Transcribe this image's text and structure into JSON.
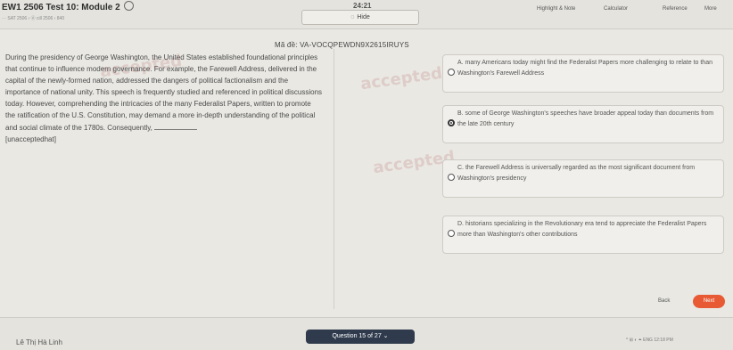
{
  "header": {
    "test_title": "EW1 2506 Test 10: Module 2",
    "breadcrumb": "··· SAT 2506 › Ⓐ cill 2506 ‹ 840",
    "timer": "24:21",
    "hide_label": "Hide",
    "tools": [
      "Highlight & Note",
      "Calculator",
      "Reference",
      "More"
    ]
  },
  "question": {
    "id_label": "Mã đề: VA-VOCQPEWDN9X2615IRUYS",
    "passage": "During the presidency of George Washington, the United States established foundational principles that continue to influence modern governance. For example, the Farewell Address, delivered in the capital of the newly-formed nation, addressed the dangers of political factionalism and the importance of national unity. This speech is frequently studied and referenced in political discussions today. However, comprehending the intricacies of the many Federalist Papers, written to promote the ratification of the U.S. Constitution, may demand a more in-depth understanding of the political and social climate of the 1780s. Consequently,",
    "passage_tail": "[unacceptedhat]",
    "choices": [
      {
        "text": "A. many Americans today might find the Federalist Papers more challenging to relate to than Washington's Farewell Address",
        "selected": false
      },
      {
        "text": "B. some of George Washington's speeches have broader appeal today than documents from the late 20th century",
        "selected": true
      },
      {
        "text": "C. the Farewell Address is universally regarded as the most significant document from Washington's presidency",
        "selected": false
      },
      {
        "text": "D. historians specializing in the Revolutionary era tend to appreciate the Federalist Papers more than Washington's other contributions",
        "selected": false
      }
    ]
  },
  "footer": {
    "student_name": "Lê Thị Hà Linh",
    "question_nav": "Question 15 of 27",
    "back_label": "Back",
    "next_label": "Next",
    "systray": "^ ⊞ ◐ ⏶ ENG  12:18 PM"
  },
  "watermark_text": "accepted",
  "colors": {
    "next_button": "#e85a34",
    "question_nav": "#2f3b4d",
    "background": "#e9e8e3"
  }
}
